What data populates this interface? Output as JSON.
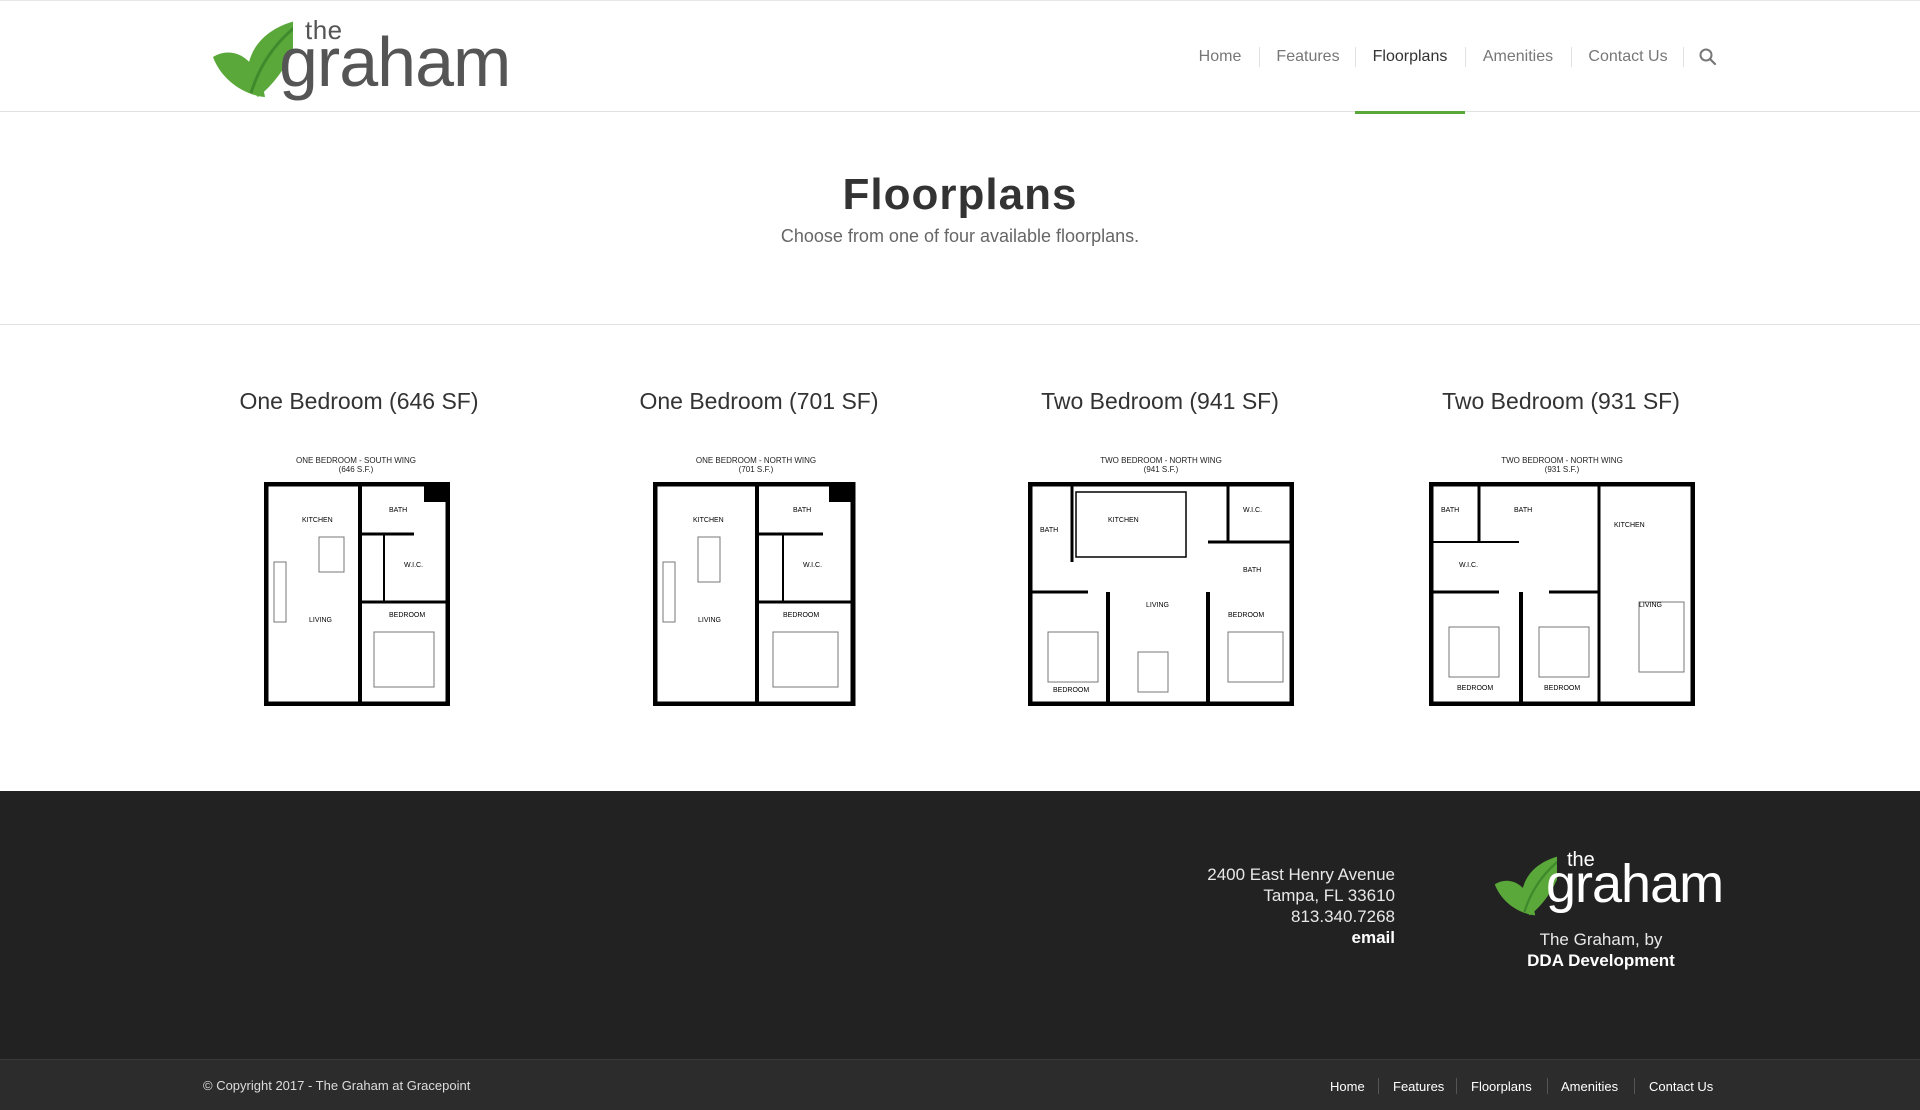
{
  "brand": {
    "logo_the": "the",
    "logo_word": "graham",
    "green": "#5aa83a",
    "dark_green": "#3f8a2c"
  },
  "nav": {
    "items": [
      {
        "label": "Home"
      },
      {
        "label": "Features"
      },
      {
        "label": "Floorplans",
        "active": true
      },
      {
        "label": "Amenities"
      },
      {
        "label": "Contact Us"
      }
    ],
    "search_icon": "search-icon"
  },
  "page": {
    "title": "Floorplans",
    "subtitle": "Choose from one of four available floorplans."
  },
  "floorplans": [
    {
      "title": "One Bedroom (646 SF)",
      "caption_line1": "ONE BEDROOM - SOUTH WING",
      "caption_line2": "(646 S.F.)"
    },
    {
      "title": "One Bedroom (701 SF)",
      "caption_line1": "ONE BEDROOM - NORTH WING",
      "caption_line2": "(701 S.F.)"
    },
    {
      "title": "Two Bedroom (941 SF)",
      "caption_line1": "TWO BEDROOM - NORTH WING",
      "caption_line2": "(941 S.F.)"
    },
    {
      "title": "Two Bedroom (931 SF)",
      "caption_line1": "TWO BEDROOM - NORTH WING",
      "caption_line2": "(931 S.F.)"
    }
  ],
  "footer": {
    "address_line1": "2400 East Henry Avenue",
    "address_line2": "Tampa, FL 33610",
    "phone": "813.340.7268",
    "email_label": "email",
    "logo_the": "the",
    "logo_word": "graham",
    "tagline": "The Graham, by",
    "developer": "DDA Development",
    "copyright": "© Copyright 2017 - The Graham at Gracepoint",
    "nav": [
      {
        "label": "Home"
      },
      {
        "label": "Features"
      },
      {
        "label": "Floorplans"
      },
      {
        "label": "Amenities"
      },
      {
        "label": "Contact Us"
      }
    ]
  }
}
